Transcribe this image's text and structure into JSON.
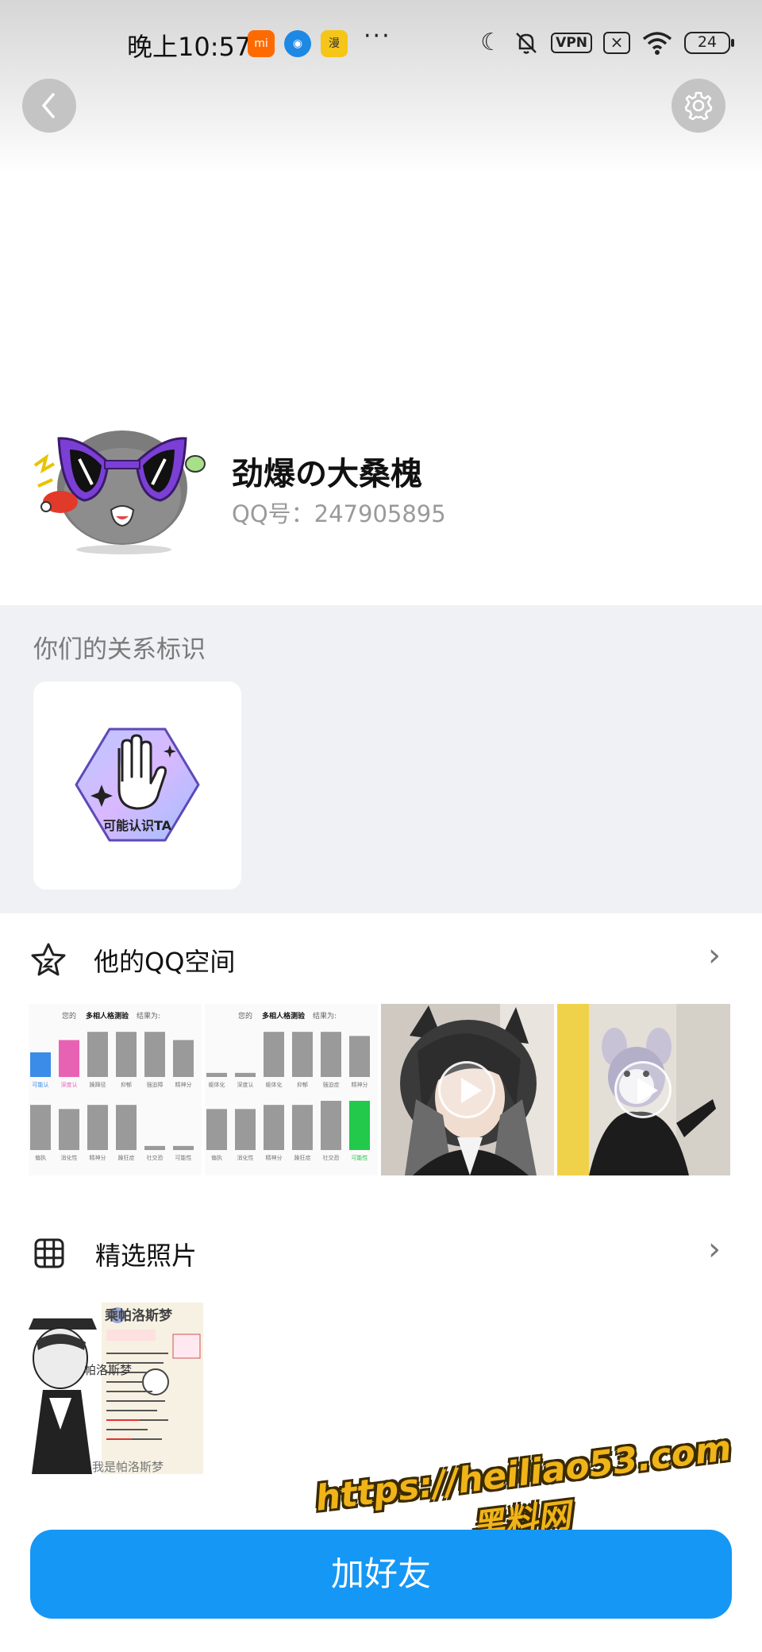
{
  "status_bar": {
    "time": "晚上10:57",
    "apps": [
      {
        "name": "xiaomi-app-icon",
        "glyph": "mi",
        "color": "#ff6a00"
      },
      {
        "name": "browser-app-icon",
        "glyph": "◉",
        "color": "#1e88e5"
      },
      {
        "name": "comic-app-icon",
        "glyph": "漫",
        "color": "#f5c518"
      }
    ],
    "more": "···",
    "vpn_label": "VPN",
    "sim_label": "×",
    "battery": "24"
  },
  "profile": {
    "name": "劲爆の大桑槐",
    "qq_label": "QQ号：",
    "qq_number": "247905895"
  },
  "relationship": {
    "title": "你们的关系标识",
    "badge_label": "可能认识TA"
  },
  "qzone": {
    "title": "他的QQ空间",
    "chart1": {
      "title_a": "您的",
      "title_b": "多相人格测验",
      "title_c": "结果为:",
      "row1": [
        "可能认同",
        "深度认同",
        "躁蹿径",
        "抑郁",
        "强迫障碍",
        "精神分裂倾向"
      ],
      "row2": [
        "偏执",
        "消化性失调",
        "精神分裂",
        "躁狂症",
        "社交恐惧",
        "可能性"
      ],
      "row1_values": [
        0.3,
        0.45,
        0.55,
        0.55,
        0.55,
        0.45
      ],
      "row2_values": [
        0.55,
        0.5,
        0.55,
        0.55,
        0.05,
        0.05
      ],
      "row1_colors": [
        "#3b8be8",
        "#e862b3",
        "#9a9a9a",
        "#9a9a9a",
        "#9a9a9a",
        "#9a9a9a"
      ],
      "row2_colors": [
        "#9a9a9a",
        "#9a9a9a",
        "#9a9a9a",
        "#9a9a9a",
        "#9a9a9a",
        "#9a9a9a"
      ]
    },
    "chart2": {
      "title_a": "您的",
      "title_b": "多相人格测验",
      "title_c": "结果为:",
      "row1": [
        "躯体化症状",
        "深度认同",
        "躯体化症",
        "抑郁",
        "强迫症状",
        "精神分裂障碍"
      ],
      "row2": [
        "偏执",
        "消化性障碍",
        "精神分裂",
        "躁狂症",
        "社交恐惧",
        "可能性"
      ],
      "row1_values": [
        0.05,
        0.05,
        0.55,
        0.55,
        0.55,
        0.5
      ],
      "row2_values": [
        0.5,
        0.5,
        0.55,
        0.55,
        0.6,
        0.6
      ],
      "row1_colors": [
        "#9a9a9a",
        "#9a9a9a",
        "#9a9a9a",
        "#9a9a9a",
        "#9a9a9a",
        "#9a9a9a"
      ],
      "row2_colors": [
        "#9a9a9a",
        "#9a9a9a",
        "#9a9a9a",
        "#9a9a9a",
        "#9a9a9a",
        "#22c94a"
      ]
    }
  },
  "featured": {
    "title": "精选照片",
    "photo_text_1": "乘帕洛斯梦",
    "photo_text_2": "帕洛斯梦",
    "photo_text_3": "我是帕洛斯梦"
  },
  "add_friend_label": "加好友",
  "watermark": {
    "url": "https://heiliao53.com",
    "name": "黑料网"
  },
  "colors": {
    "primary_blue": "#1597f5",
    "watermark_gold": "#f0b418"
  }
}
